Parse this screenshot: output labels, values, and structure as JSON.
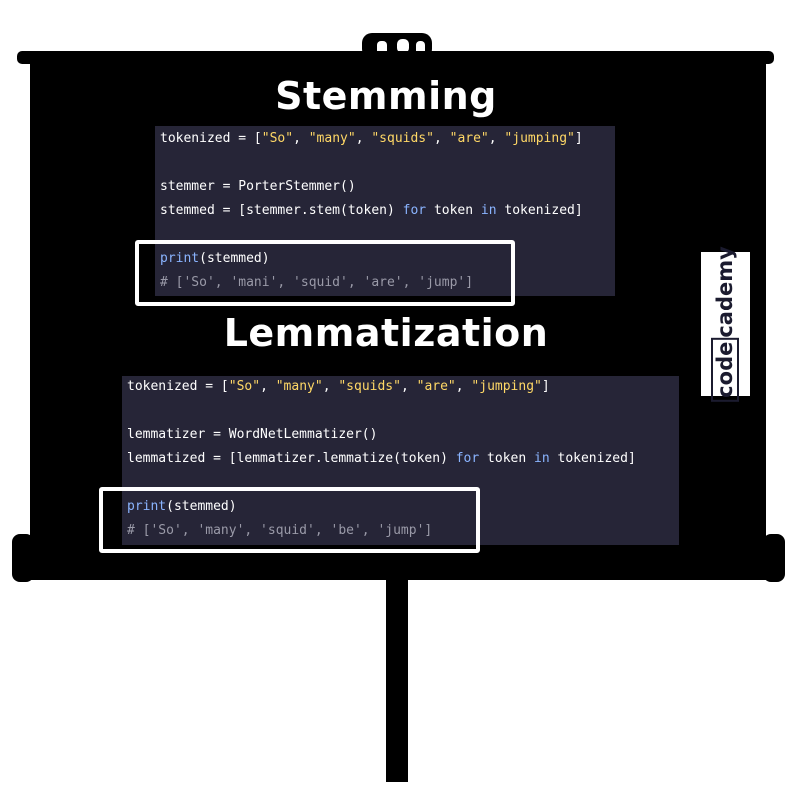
{
  "stemming": {
    "title": "Stemming",
    "lines": {
      "l1": {
        "a": "tokenized = [",
        "s1": "\"So\"",
        "c1": ", ",
        "s2": "\"many\"",
        "c2": ", ",
        "s3": "\"squids\"",
        "c3": ", ",
        "s4": "\"are\"",
        "c4": ", ",
        "s5": "\"jumping\"",
        "z": "]"
      },
      "l2": {
        "a": "stemmer = PorterStemmer()"
      },
      "l3": {
        "a": "stemmed = [stemmer.stem(token) ",
        "kw1": "for",
        "b": " token ",
        "kw2": "in",
        "c": " tokenized]"
      },
      "l4": {
        "fn": "print",
        "a": "(stemmed)"
      },
      "l5": {
        "comment": "# ['So', 'mani', 'squid', 'are', 'jump']"
      }
    }
  },
  "lemmatization": {
    "title": "Lemmatization",
    "lines": {
      "l1": {
        "a": "tokenized = [",
        "s1": "\"So\"",
        "c1": ", ",
        "s2": "\"many\"",
        "c2": ", ",
        "s3": "\"squids\"",
        "c3": ", ",
        "s4": "\"are\"",
        "c4": ", ",
        "s5": "\"jumping\"",
        "z": "]"
      },
      "l2": {
        "a": "lemmatizer = WordNetLemmatizer()"
      },
      "l3": {
        "a": "lemmatized = [lemmatizer.lemmatize(token) ",
        "kw1": "for",
        "b": " token ",
        "kw2": "in",
        "c": " tokenized]"
      },
      "l4": {
        "fn": "print",
        "a": "(stemmed)"
      },
      "l5": {
        "comment": "# ['So', 'many', 'squid', 'be', 'jump']"
      }
    }
  },
  "logo": {
    "part1": "code",
    "part2": "cademy"
  },
  "colors": {
    "screen": "#000000",
    "code_bg": "#262537",
    "string": "#ffd866",
    "keyword": "#8ab4ff",
    "comment": "#9a9aa8",
    "highlight": "#ffffff"
  },
  "icons": {
    "screen": "projector-screen-icon"
  }
}
